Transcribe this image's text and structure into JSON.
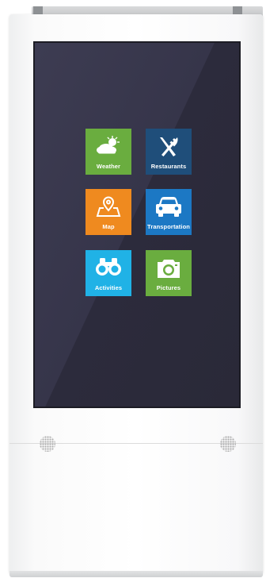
{
  "kiosk": {
    "tiles": [
      {
        "label": "Weather",
        "icon": "weather-icon",
        "color": "#6aad3f"
      },
      {
        "label": "Restaurants",
        "icon": "fork-knife-icon",
        "color": "#1f4e7a"
      },
      {
        "label": "Map",
        "icon": "map-pin-icon",
        "color": "#ef8a1f"
      },
      {
        "label": "Transportation",
        "icon": "car-icon",
        "color": "#1c78c4"
      },
      {
        "label": "Activities",
        "icon": "binoculars-icon",
        "color": "#20b2e6"
      },
      {
        "label": "Pictures",
        "icon": "camera-icon",
        "color": "#6aad3f"
      }
    ],
    "screen_color": "#36354a"
  }
}
